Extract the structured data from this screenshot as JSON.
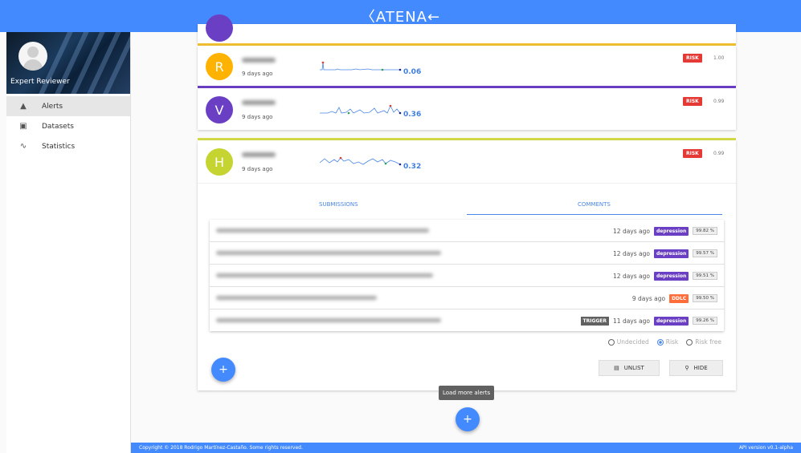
{
  "brand": "〈ATENA←",
  "sidebar": {
    "profile_name": "Expert Reviewer",
    "items": [
      {
        "label": "Alerts",
        "icon": "warning-icon"
      },
      {
        "label": "Datasets",
        "icon": "dataset-icon"
      },
      {
        "label": "Statistics",
        "icon": "trend-icon"
      }
    ]
  },
  "alerts": [
    {
      "letter": "R",
      "color": "#ffb300",
      "accent": "#f0c030",
      "ago": "9 days ago",
      "score": "0.06",
      "risk_label": "RISK",
      "confidence": "1.00"
    },
    {
      "letter": "V",
      "color": "#6a3fc3",
      "accent": "#6a3fc3",
      "ago": "9 days ago",
      "score": "0.36",
      "risk_label": "RISK",
      "confidence": "0.99"
    },
    {
      "letter": "H",
      "color": "#c6d432",
      "accent": "#d4dc4a",
      "ago": "9 days ago",
      "score": "0.32",
      "risk_label": "RISK",
      "confidence": "0.99"
    }
  ],
  "tabs": {
    "submissions": "SUBMISSIONS",
    "comments": "COMMENTS"
  },
  "comments": [
    {
      "ago": "12 days ago",
      "tag": "depression",
      "tag_color": "#6a3fc3",
      "pct": "99.82 %"
    },
    {
      "ago": "12 days ago",
      "tag": "depression",
      "tag_color": "#6a3fc3",
      "pct": "99.57 %"
    },
    {
      "ago": "12 days ago",
      "tag": "depression",
      "tag_color": "#6a3fc3",
      "pct": "99.51 %"
    },
    {
      "ago": "9 days ago",
      "tag": "DDLC",
      "tag_color": "#ff6d3a",
      "pct": "99.50 %"
    },
    {
      "trigger": "TRIGGER",
      "ago": "11 days ago",
      "tag": "depression",
      "tag_color": "#6a3fc3",
      "pct": "99.26 %"
    }
  ],
  "decision": {
    "options": [
      "Undecided",
      "Risk",
      "Risk free"
    ],
    "selected": "Risk"
  },
  "buttons": {
    "unlist": "UNLIST",
    "hide": "HIDE",
    "add": "+",
    "load_more": "+"
  },
  "tooltip": "Load more alerts",
  "footer": {
    "copyright": "Copyright © 2018 Rodrigo Martínez-Castaño. Some rights reserved.",
    "version": "API version v0.1-alpha"
  }
}
